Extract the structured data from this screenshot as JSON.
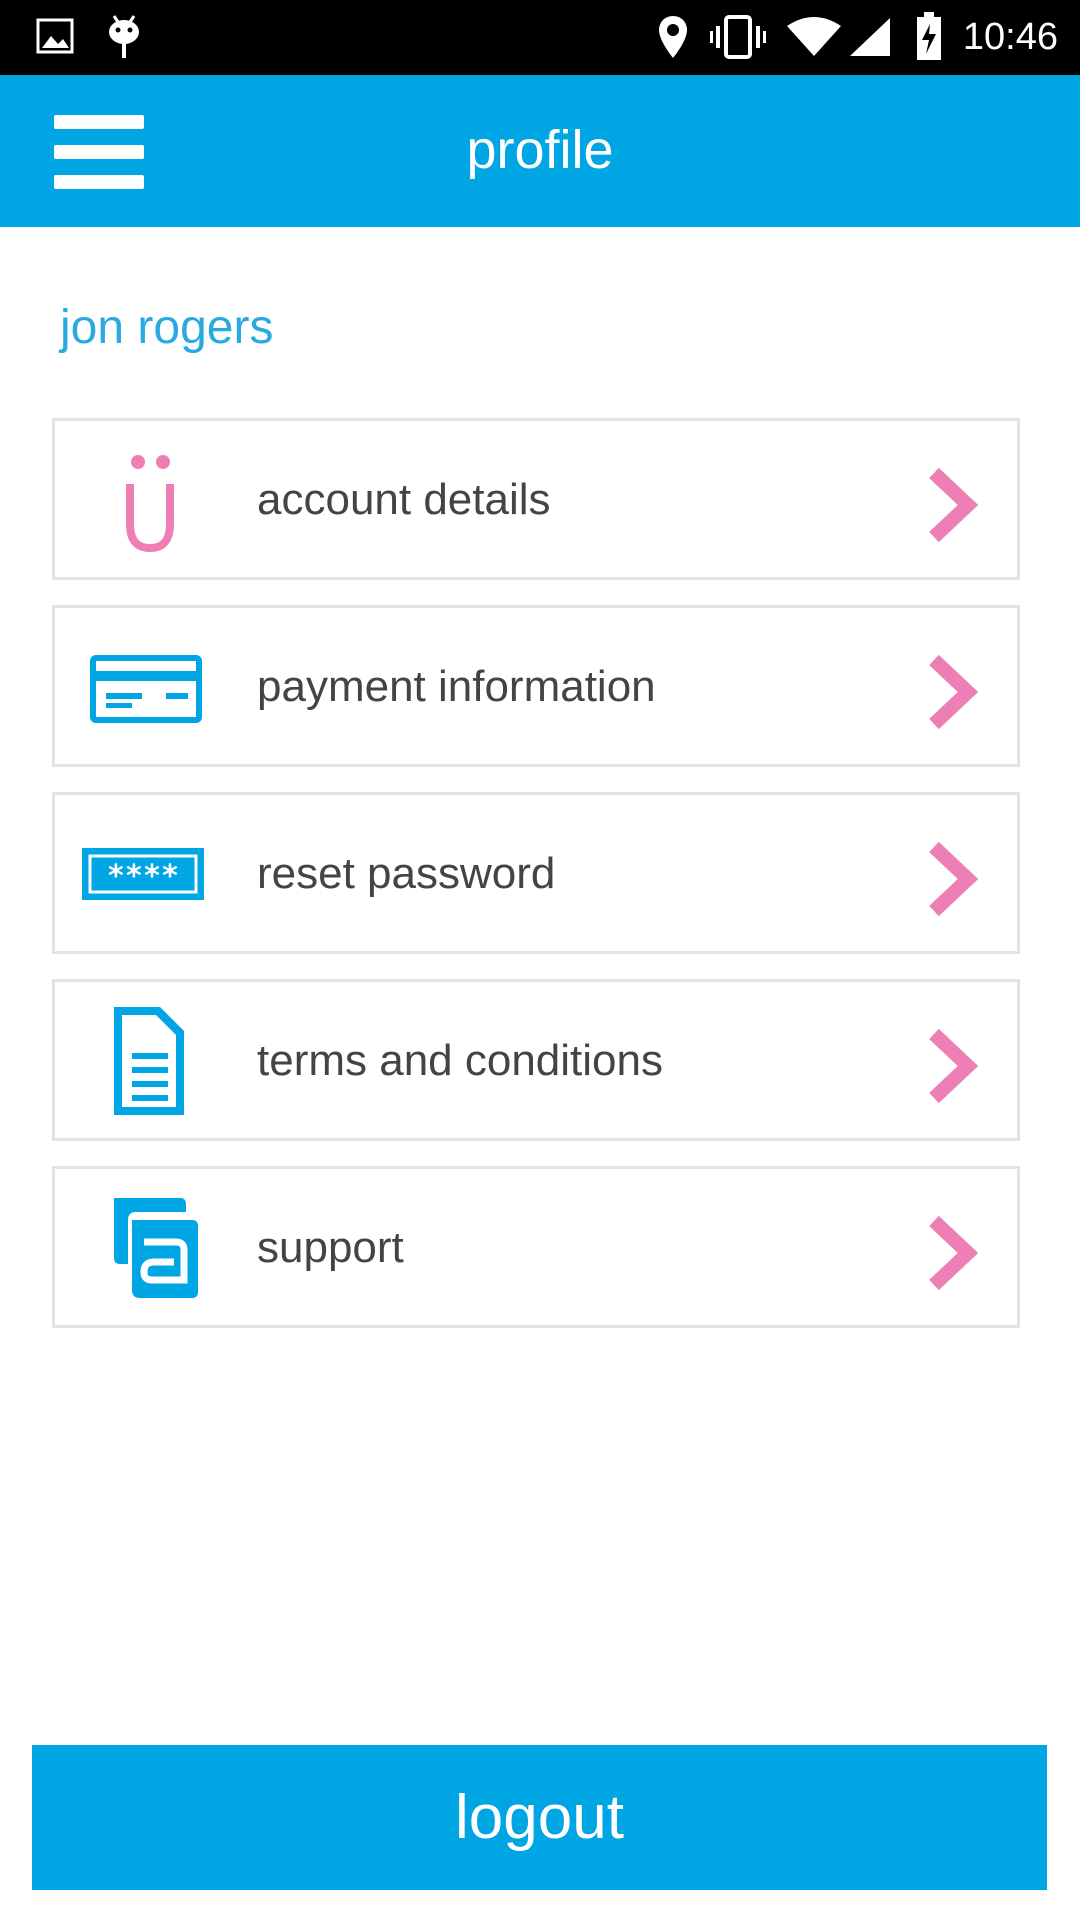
{
  "status_bar": {
    "time": "10:46",
    "left_icons": [
      "image-icon",
      "android-icon"
    ],
    "right_icons": [
      "location-icon",
      "vibrate-icon",
      "wifi-icon",
      "signal-icon",
      "battery-charging-icon"
    ]
  },
  "app_bar": {
    "title": "profile",
    "menu_icon": "hamburger-menu-icon"
  },
  "user": {
    "name": "jon rogers"
  },
  "menu": {
    "items": [
      {
        "label": "account details",
        "icon": "account-smiley-icon"
      },
      {
        "label": "payment information",
        "icon": "credit-card-icon"
      },
      {
        "label": "reset password",
        "icon": "password-field-icon"
      },
      {
        "label": "terms and conditions",
        "icon": "document-icon"
      },
      {
        "label": "support",
        "icon": "support-chat-icon"
      }
    ]
  },
  "logout_label": "logout",
  "colors": {
    "primary": "#00a5e3",
    "accent_pink": "#ee7fb5",
    "text_dark": "#444444",
    "border": "#e3e3e3"
  }
}
